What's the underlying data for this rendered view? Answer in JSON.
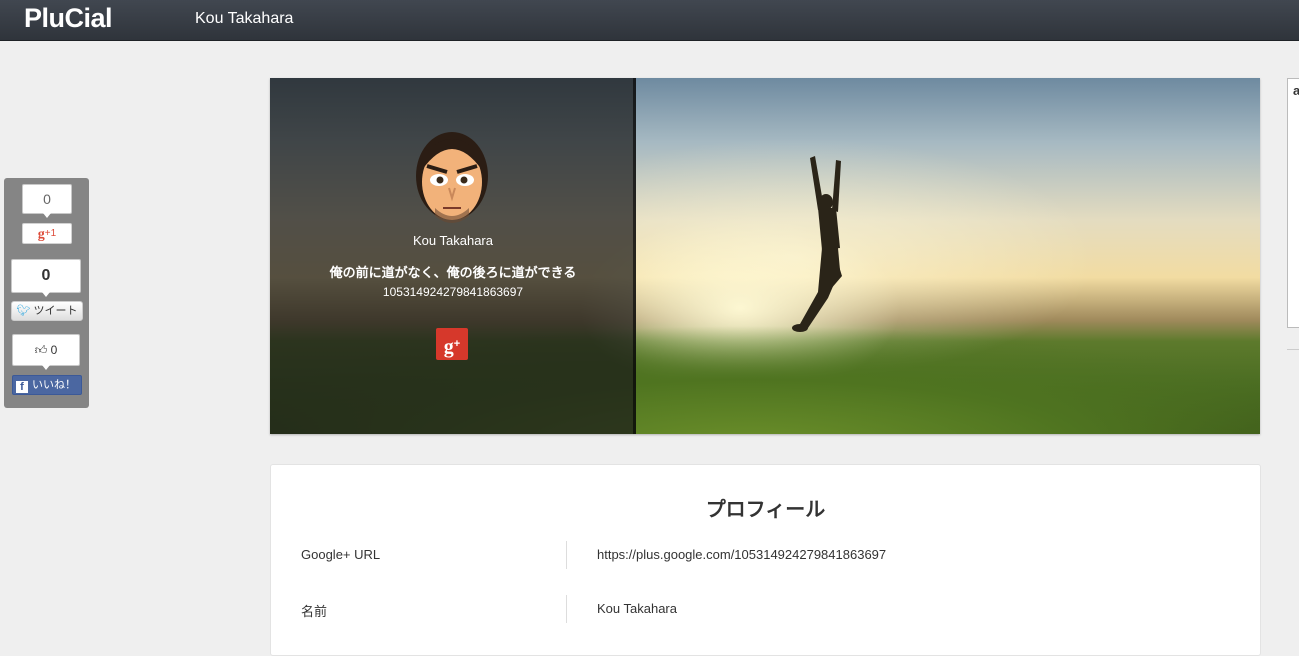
{
  "navbar": {
    "brand": "PluCial",
    "user_name": "Kou Takahara"
  },
  "share": {
    "gplus_count": "0",
    "gplus_label": "+1",
    "tweet_count": "0",
    "tweet_label": "ツイート",
    "like_count": "0",
    "like_label": "いいね！"
  },
  "profile": {
    "name": "Kou Takahara",
    "tagline": "俺の前に道がなく、俺の後ろに道ができる",
    "id": "105314924279841863697"
  },
  "ad": {
    "text": "a"
  },
  "card": {
    "title": "プロフィール",
    "rows": [
      {
        "label": "Google+ URL",
        "value": "https://plus.google.com/105314924279841863697"
      },
      {
        "label": "名前",
        "value": "Kou Takahara"
      }
    ]
  },
  "colors": {
    "navbar": "#353a41",
    "gplus_red": "#d6382b",
    "facebook_blue": "#4b67a1",
    "twitter_blue": "#2ea8e0"
  },
  "icons": [
    "gplus-icon",
    "twitter-bird-icon",
    "thumbs-up-icon",
    "facebook-icon",
    "avatar-cartoon"
  ]
}
